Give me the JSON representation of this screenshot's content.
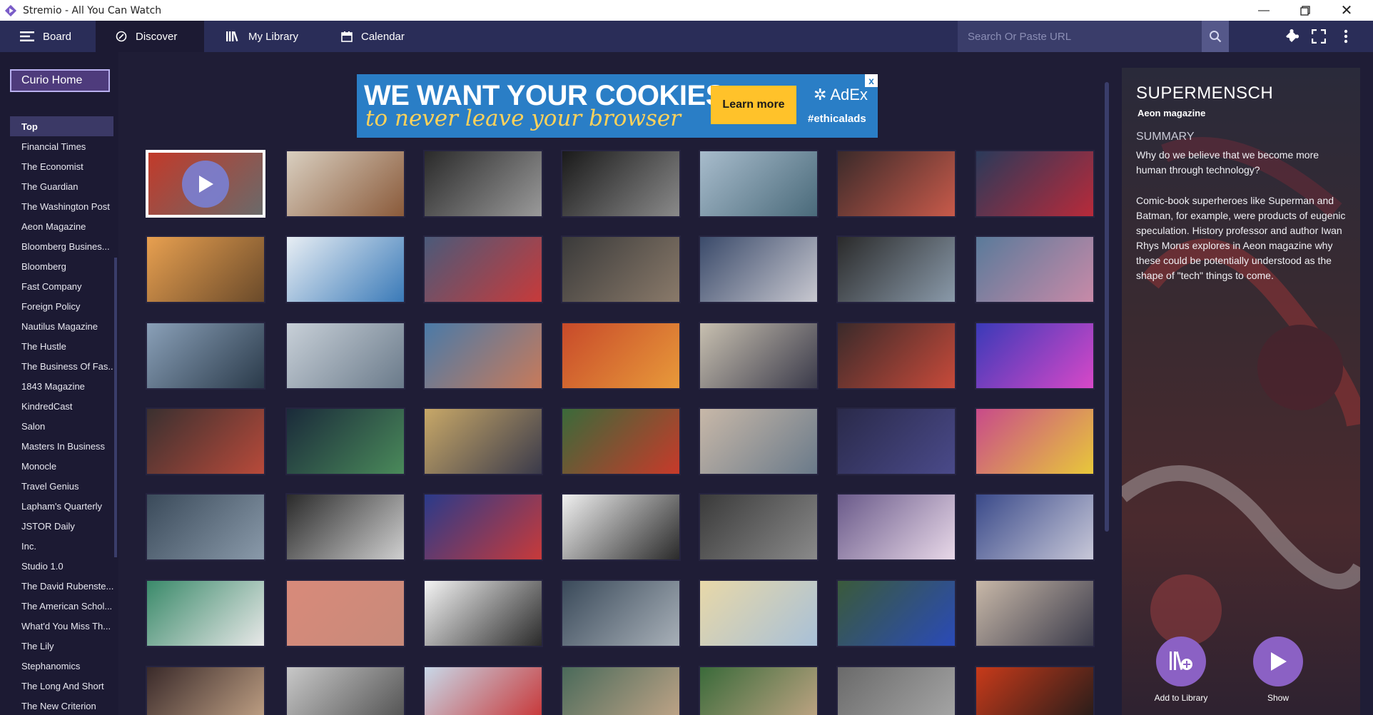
{
  "window": {
    "title": "Stremio - All You Can Watch"
  },
  "nav": {
    "tabs": [
      {
        "label": "Board",
        "icon": "menu-icon"
      },
      {
        "label": "Discover",
        "icon": "compass-icon"
      },
      {
        "label": "My Library",
        "icon": "library-icon"
      },
      {
        "label": "Calendar",
        "icon": "calendar-icon"
      }
    ],
    "active_tab": "Discover",
    "search_placeholder": "Search Or Paste URL"
  },
  "sidebar": {
    "catalog_button": "Curio Home",
    "items": [
      "Top",
      "Financial Times",
      "The Economist",
      "The Guardian",
      "The Washington Post",
      "Aeon Magazine",
      "Bloomberg Busines...",
      "Bloomberg",
      "Fast Company",
      "Foreign Policy",
      "Nautilus Magazine",
      "The Hustle",
      "The Business Of Fas...",
      "1843 Magazine",
      "KindredCast",
      "Salon",
      "Masters In Business",
      "Monocle",
      "Travel Genius",
      "Lapham's Quarterly",
      "JSTOR Daily",
      "Inc.",
      "Studio 1.0",
      "The David Rubenste...",
      "The American Schol...",
      "What'd You Miss Th...",
      "The Lily",
      "Stephanomics",
      "The Long And Short",
      "The New Criterion"
    ],
    "active_item": "Top"
  },
  "ad": {
    "headline": "WE WANT YOUR COOKIES",
    "subline": "to never leave your browser",
    "button": "Learn more",
    "brand": "AdEx",
    "tag": "#ethicalads",
    "close": "x"
  },
  "grid": {
    "tiles": [
      [
        "#c23a2a",
        "#6a6a6a"
      ],
      [
        "#d9cfc0",
        "#8a5a3a"
      ],
      [
        "#2a2a2a",
        "#9a9a9a"
      ],
      [
        "#1a1a1a",
        "#8a8a8a"
      ],
      [
        "#a8bccc",
        "#4a6a7a"
      ],
      [
        "#3a2a2a",
        "#c85a4a"
      ],
      [
        "#2a3a5a",
        "#b82a3a"
      ],
      [
        "#e8a050",
        "#6a4a2a"
      ],
      [
        "#e8eef4",
        "#3a7ab8"
      ],
      [
        "#4a5a7a",
        "#c83a3a"
      ],
      [
        "#3a3a3a",
        "#8a7a6a"
      ],
      [
        "#3a4a6a",
        "#c8c8d0"
      ],
      [
        "#2a2a2a",
        "#8a9aaa"
      ],
      [
        "#5a7a9a",
        "#c88aa8"
      ],
      [
        "#8aa0b8",
        "#2a3a4a"
      ],
      [
        "#c8d0d8",
        "#6a7a8a"
      ],
      [
        "#4a7aa8",
        "#c87a5a"
      ],
      [
        "#c84a2a",
        "#e89a3a"
      ],
      [
        "#c8c0b0",
        "#3a3a4a"
      ],
      [
        "#3a2a2a",
        "#c84a3a"
      ],
      [
        "#3a3ab8",
        "#d848c8"
      ],
      [
        "#3a3030",
        "#b84a3a"
      ],
      [
        "#1a2a3a",
        "#4a8a5a"
      ],
      [
        "#c8a868",
        "#3a3a4a"
      ],
      [
        "#3a6a3a",
        "#c83a2a"
      ],
      [
        "#c8b8a8",
        "#6a7a8a"
      ],
      [
        "#2a2a4a",
        "#4a4a8a"
      ],
      [
        "#c84a8a",
        "#e8c83a"
      ],
      [
        "#3a4a5a",
        "#8a9aaa"
      ],
      [
        "#2a2a2a",
        "#d0d0d0"
      ],
      [
        "#2a3a8a",
        "#c83a3a"
      ],
      [
        "#f0f0f0",
        "#2a2a2a"
      ],
      [
        "#3a3a3a",
        "#8a8a8a"
      ],
      [
        "#6a5a8a",
        "#e8d8e8"
      ],
      [
        "#3a4a8a",
        "#c8c8d8"
      ],
      [
        "#3a8a6a",
        "#e8e8e8"
      ],
      [
        "#d88a7a",
        "#c88a7a"
      ],
      [
        "#f4f4f4",
        "#2a2a2a"
      ],
      [
        "#3a4a5a",
        "#a8b0b8"
      ],
      [
        "#e8d8a8",
        "#a8c0d8"
      ],
      [
        "#3a5a3a",
        "#2a4ab8"
      ],
      [
        "#c8b8a8",
        "#3a3a4a"
      ],
      [
        "#3a2a2a",
        "#c8a88a"
      ],
      [
        "#c8c8c8",
        "#4a4a4a"
      ],
      [
        "#c8d8e8",
        "#c82a2a"
      ],
      [
        "#4a6a5a",
        "#c8a88a"
      ],
      [
        "#3a6a3a",
        "#c8a888"
      ],
      [
        "#6a6a6a",
        "#aaaaaa"
      ],
      [
        "#c83a1a",
        "#1a1a1a"
      ]
    ]
  },
  "details": {
    "title": "SUPERMENSCH",
    "source": "Aeon magazine",
    "summary_heading": "SUMMARY",
    "summary_lead": "Why do we believe that we become more human through technology?",
    "summary_body": "Comic-book superheroes like Superman and Batman, for example, were products of eugenic speculation. History professor and author Iwan Rhys Morus explores in Aeon magazine why these could be potentially understood as the shape of \"tech\" things to come.",
    "add_to_library": "Add to Library",
    "show": "Show"
  }
}
